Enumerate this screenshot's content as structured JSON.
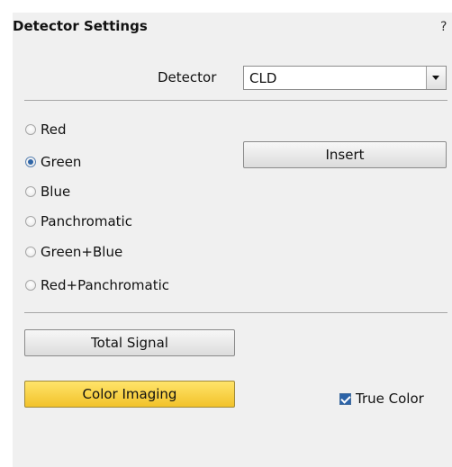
{
  "panel": {
    "title": "Detector Settings",
    "help": "?"
  },
  "detector": {
    "label": "Detector",
    "value": "CLD"
  },
  "insert_label": "Insert",
  "radios": [
    {
      "label": "Red",
      "selected": false
    },
    {
      "label": "Green",
      "selected": true
    },
    {
      "label": "Blue",
      "selected": false
    },
    {
      "label": "Panchromatic",
      "selected": false
    },
    {
      "label": "Green+Blue",
      "selected": false
    },
    {
      "label": "Red+Panchromatic",
      "selected": false
    }
  ],
  "total_signal_label": "Total Signal",
  "color_imaging_label": "Color Imaging",
  "true_color": {
    "label": "True Color",
    "checked": true
  },
  "colors": {
    "panel_bg": "#f0f0f0",
    "highlight_button": "#f5c835",
    "selected_radio": "#2f65a6"
  }
}
